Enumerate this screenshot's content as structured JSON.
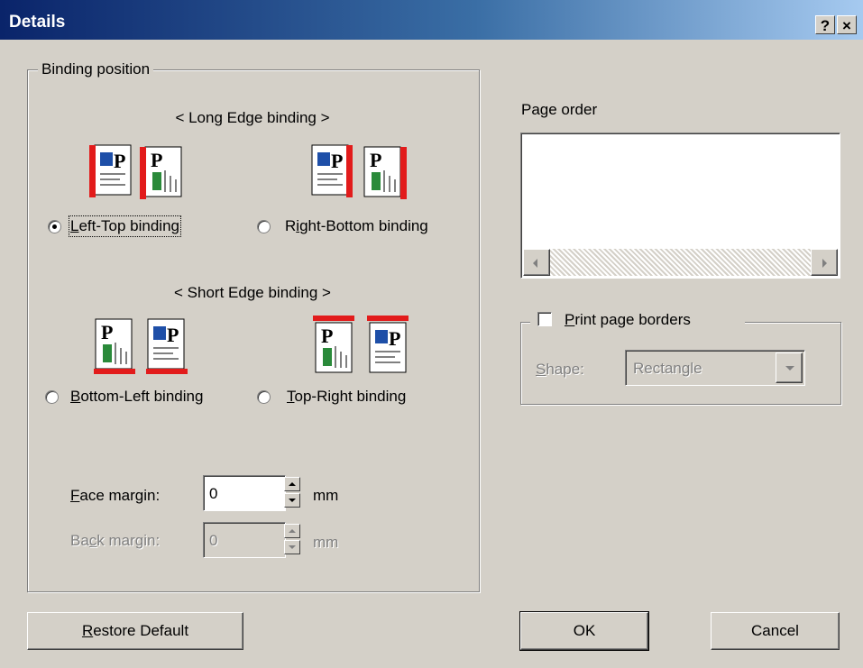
{
  "window": {
    "title": "Details",
    "help_label": "?",
    "close_label": "×"
  },
  "binding_position": {
    "group_label": "Binding position",
    "long_edge_heading": "< Long Edge binding >",
    "short_edge_heading": "< Short Edge binding >",
    "options": {
      "left_top": {
        "label": "Left-Top binding",
        "mnemonic": "L",
        "rest": "eft-Top binding",
        "checked": true
      },
      "right_bottom": {
        "label": "Right-Bottom binding",
        "pre": "R",
        "mnemonic": "i",
        "rest": "ght-Bottom binding",
        "checked": false
      },
      "bottom_left": {
        "label": "Bottom-Left binding",
        "mnemonic": "B",
        "rest": "ottom-Left binding",
        "checked": false
      },
      "top_right": {
        "label": "Top-Right binding",
        "mnemonic": "T",
        "rest": "op-Right binding",
        "checked": false
      }
    },
    "face_margin": {
      "pre": "",
      "mnemonic": "F",
      "rest": "ace margin:",
      "value": "0",
      "unit": "mm"
    },
    "back_margin": {
      "pre": "Ba",
      "mnemonic": "c",
      "rest": "k margin:",
      "value": "0",
      "unit": "mm"
    }
  },
  "page_order": {
    "label": "Page order"
  },
  "print_borders": {
    "mnemonic": "P",
    "rest": "rint page borders",
    "checked": false,
    "shape_mnemonic": "S",
    "shape_rest": "hape:",
    "shape_value": "Rectangle"
  },
  "buttons": {
    "restore_mnemonic": "R",
    "restore_rest": "estore Default",
    "ok": "OK",
    "cancel": "Cancel"
  },
  "colors": {
    "binding_bar": "#e21b1b",
    "title_start": "#0a246a",
    "title_end": "#a6caf0"
  }
}
